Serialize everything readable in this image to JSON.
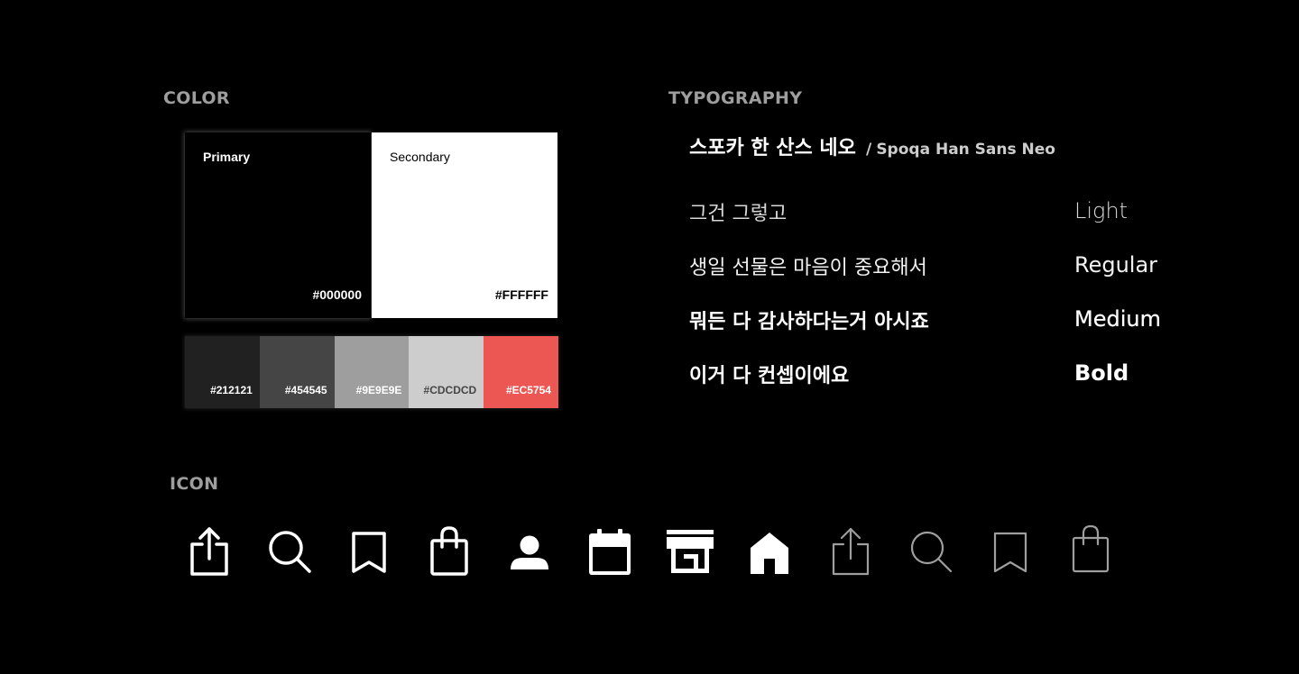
{
  "sections": {
    "color": "COLOR",
    "typography": "TYPOGRAPHY",
    "icon": "ICON"
  },
  "colors": {
    "primary": {
      "label": "Primary",
      "hex": "#000000"
    },
    "secondary": {
      "label": "Secondary",
      "hex": "#FFFFFF"
    },
    "palette": [
      {
        "hex": "#212121",
        "text_color": "#ffffff"
      },
      {
        "hex": "#454545",
        "text_color": "#ffffff"
      },
      {
        "hex": "#9E9E9E",
        "text_color": "#ffffff"
      },
      {
        "hex": "#CDCDCD",
        "text_color": "#454545"
      },
      {
        "hex": "#EC5754",
        "text_color": "#ffffff"
      }
    ]
  },
  "typography": {
    "font_name_ko": "스포카 한 산스 네오",
    "separator": "/",
    "font_name_en": "Spoqa Han Sans Neo",
    "samples": [
      {
        "text": "그건 그렇고",
        "weight": "Light"
      },
      {
        "text": "생일 선물은 마음이 중요해서",
        "weight": "Regular"
      },
      {
        "text": "뭐든 다 감사하다는거 아시죠",
        "weight": "Medium"
      },
      {
        "text": "이거 다 컨셉이에요",
        "weight": "Bold"
      }
    ]
  },
  "icons": {
    "filled": [
      "share-icon",
      "search-icon",
      "bookmark-icon",
      "shopping-bag-icon",
      "person-icon",
      "calendar-icon",
      "store-icon",
      "home-icon"
    ],
    "outlined": [
      "share-icon",
      "search-icon",
      "bookmark-icon",
      "shopping-bag-icon"
    ],
    "colors": {
      "active": "#ffffff",
      "inactive": "#9e9e9e"
    }
  }
}
